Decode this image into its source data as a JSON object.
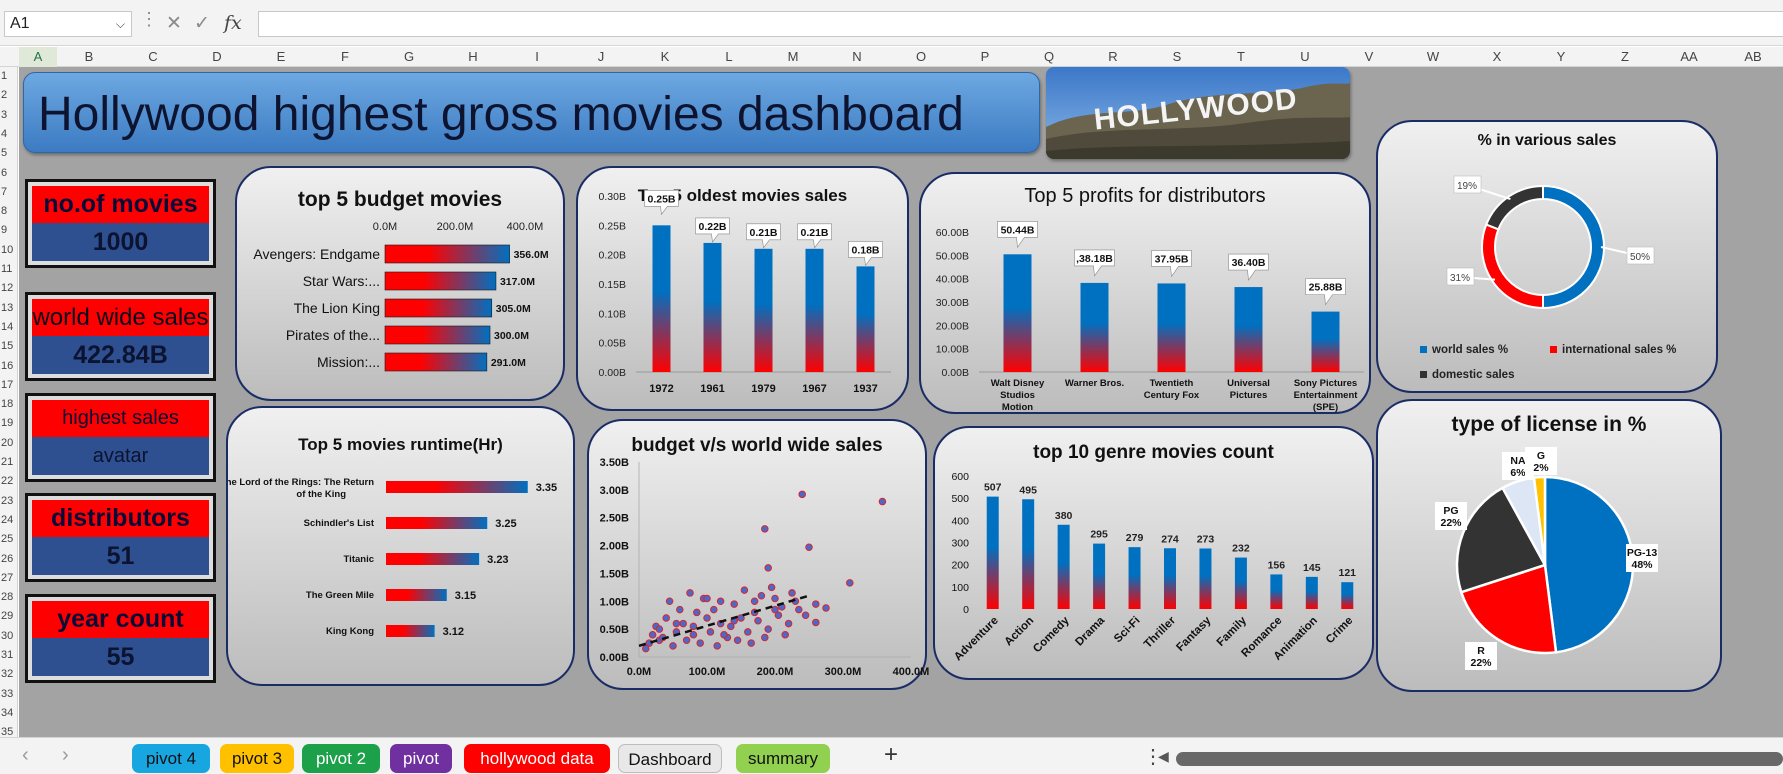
{
  "formula_bar": {
    "name_box": "A1",
    "fx": "fx",
    "formula": ""
  },
  "columns": [
    "A",
    "B",
    "C",
    "D",
    "E",
    "F",
    "G",
    "H",
    "I",
    "J",
    "K",
    "L",
    "M",
    "N",
    "O",
    "P",
    "Q",
    "R",
    "S",
    "T",
    "U",
    "V",
    "W",
    "X",
    "Y",
    "Z",
    "AA",
    "AB"
  ],
  "rows": [
    "1",
    "2",
    "3",
    "4",
    "5",
    "6",
    "7",
    "8",
    "9",
    "10",
    "11",
    "12",
    "13",
    "14",
    "15",
    "16",
    "17",
    "18",
    "19",
    "20",
    "21",
    "22",
    "23",
    "24",
    "25",
    "26",
    "27",
    "28",
    "29",
    "30",
    "31",
    "32",
    "33",
    "34",
    "35"
  ],
  "dashboard": {
    "title": "Hollywood highest gross movies dashboard",
    "banner_text": "HOLLYWOOD",
    "kpis": [
      {
        "label": "no.of movies",
        "value": "1000"
      },
      {
        "label": "world wide sales",
        "value": "422.84B"
      },
      {
        "label": "highest sales",
        "value": "avatar"
      },
      {
        "label": "distributors",
        "value": "51"
      },
      {
        "label": "year count",
        "value": "55"
      }
    ]
  },
  "chart_data": [
    {
      "id": "budget",
      "type": "bar",
      "orientation": "horizontal",
      "title": "top 5 budget movies",
      "categories": [
        "Avengers: Endgame",
        "Star Wars:...",
        "The Lion King",
        "Pirates of the...",
        "Mission:..."
      ],
      "values": [
        356,
        317,
        305,
        300,
        291
      ],
      "data_labels": [
        "356.0M",
        "317.0M",
        "305.0M",
        "300.0M",
        "291.0M"
      ],
      "xlim": [
        0,
        400
      ],
      "tick_labels": [
        "0.0M",
        "200.0M",
        "400.0M"
      ]
    },
    {
      "id": "oldest",
      "type": "bar",
      "title": "Top 5 oldest movies sales",
      "categories": [
        "1972",
        "1961",
        "1979",
        "1967",
        "1937"
      ],
      "values": [
        0.25,
        0.22,
        0.21,
        0.21,
        0.18
      ],
      "data_labels": [
        "0.25B",
        "0.22B",
        "0.21B",
        "0.21B",
        "0.18B"
      ],
      "ylim": [
        0,
        0.3
      ],
      "tick_labels": [
        "0.30B",
        "0.25B",
        "0.20B",
        "0.15B",
        "0.10B",
        "0.05B",
        "0.00B"
      ]
    },
    {
      "id": "profits",
      "type": "bar",
      "title": "Top 5 profits for distributors",
      "categories": [
        "Walt Disney Studios Motion Pictures",
        "Warner Bros.",
        "Twentieth Century Fox",
        "Universal Pictures",
        "Sony Pictures Entertainment (SPE)"
      ],
      "values": [
        50.44,
        38.18,
        37.95,
        36.4,
        25.88
      ],
      "data_labels": [
        "50.44B",
        ",38.18B",
        "37.95B",
        "36.40B",
        "25.88B"
      ],
      "ylim": [
        0,
        60
      ],
      "tick_labels": [
        "60.00B",
        "50.00B",
        "40.00B",
        "30.00B",
        "20.00B",
        "10.00B",
        "0.00B"
      ]
    },
    {
      "id": "sales_pct",
      "type": "pie",
      "subtype": "donut",
      "title": "% in various sales",
      "series": [
        {
          "name": "world sales %",
          "value": 50,
          "label": "50%"
        },
        {
          "name": "international sales %",
          "value": 31,
          "label": "31%"
        },
        {
          "name": "domestic sales",
          "value": 19,
          "label": "19%"
        }
      ],
      "colors": [
        "#0070c0",
        "#ff0000",
        "#333333"
      ]
    },
    {
      "id": "runtime",
      "type": "bar",
      "orientation": "horizontal",
      "title": "Top 5 movies runtime(Hr)",
      "categories": [
        "The Lord of the Rings: The Return of the King",
        "Schindler's List",
        "Titanic",
        "The Green Mile",
        "King Kong"
      ],
      "values": [
        3.35,
        3.25,
        3.23,
        3.15,
        3.12
      ],
      "data_labels": [
        "3.35",
        "3.25",
        "3.23",
        "3.15",
        "3.12"
      ]
    },
    {
      "id": "scatter",
      "type": "scatter",
      "title": "budget v/s world wide sales",
      "xlim": [
        0,
        400
      ],
      "ylim": [
        0,
        3.5
      ],
      "x_tick_labels": [
        "0.0M",
        "100.0M",
        "200.0M",
        "300.0M",
        "400.0M"
      ],
      "y_tick_labels": [
        "3.50B",
        "3.00B",
        "2.50B",
        "2.00B",
        "1.50B",
        "1.00B",
        "0.50B",
        "0.00B"
      ],
      "trendline": {
        "x": [
          0,
          250
        ],
        "y": [
          0.2,
          1.1
        ]
      },
      "points": [
        [
          240,
          2.92
        ],
        [
          358,
          2.79
        ],
        [
          185,
          2.3
        ],
        [
          250,
          1.97
        ],
        [
          190,
          1.6
        ],
        [
          260,
          0.95
        ],
        [
          310,
          1.33
        ],
        [
          275,
          0.88
        ],
        [
          260,
          0.62
        ],
        [
          105,
          0.45
        ],
        [
          30,
          0.3
        ],
        [
          55,
          0.45
        ],
        [
          80,
          0.55
        ],
        [
          120,
          0.6
        ],
        [
          150,
          0.7
        ],
        [
          170,
          0.8
        ],
        [
          200,
          1.05
        ],
        [
          210,
          0.9
        ],
        [
          230,
          1.0
        ],
        [
          180,
          1.1
        ],
        [
          140,
          0.95
        ],
        [
          95,
          1.05
        ],
        [
          60,
          0.85
        ],
        [
          40,
          0.7
        ],
        [
          20,
          0.4
        ],
        [
          15,
          0.25
        ],
        [
          70,
          0.3
        ],
        [
          130,
          0.35
        ],
        [
          160,
          0.45
        ],
        [
          190,
          0.5
        ],
        [
          220,
          0.6
        ],
        [
          45,
          1.0
        ],
        [
          85,
          0.8
        ],
        [
          110,
          0.85
        ],
        [
          75,
          1.15
        ],
        [
          65,
          0.6
        ],
        [
          25,
          0.55
        ],
        [
          50,
          0.2
        ],
        [
          90,
          0.25
        ],
        [
          135,
          0.55
        ],
        [
          175,
          0.65
        ],
        [
          205,
          0.75
        ],
        [
          235,
          0.85
        ],
        [
          155,
          1.2
        ],
        [
          195,
          1.25
        ],
        [
          245,
          0.75
        ],
        [
          100,
          0.7
        ],
        [
          35,
          0.35
        ],
        [
          10,
          0.15
        ],
        [
          125,
          0.4
        ],
        [
          145,
          0.3
        ],
        [
          165,
          0.25
        ],
        [
          185,
          0.35
        ],
        [
          215,
          0.4
        ],
        [
          115,
          0.2
        ],
        [
          80,
          0.4
        ],
        [
          55,
          0.6
        ],
        [
          30,
          0.5
        ],
        [
          140,
          0.65
        ],
        [
          170,
          1.0
        ],
        [
          100,
          1.05
        ],
        [
          120,
          1.0
        ],
        [
          200,
          0.85
        ],
        [
          225,
          1.15
        ]
      ]
    },
    {
      "id": "genre",
      "type": "bar",
      "title": "top 10 genre movies count",
      "categories": [
        "Adventure",
        "Action",
        "Comedy",
        "Drama",
        "Sci-Fi",
        "Thriller",
        "Fantasy",
        "Family",
        "Romance",
        "Animation",
        "Crime"
      ],
      "values": [
        507,
        495,
        380,
        295,
        279,
        274,
        273,
        232,
        156,
        145,
        121
      ],
      "ylim": [
        0,
        600
      ],
      "tick_labels": [
        "600",
        "500",
        "400",
        "300",
        "200",
        "100",
        "0"
      ]
    },
    {
      "id": "license",
      "type": "pie",
      "title": "type of license in %",
      "series": [
        {
          "name": "PG-13",
          "value": 48,
          "label": "PG-13\n48%"
        },
        {
          "name": "R",
          "value": 22,
          "label": "R\n22%"
        },
        {
          "name": "PG",
          "value": 22,
          "label": "PG\n22%"
        },
        {
          "name": "NA",
          "value": 6,
          "label": "NA\n6%"
        },
        {
          "name": "G",
          "value": 2,
          "label": "G\n2%"
        }
      ],
      "colors": [
        "#0070c0",
        "#ff0000",
        "#333333",
        "#dde6f4",
        "#ffc000"
      ]
    }
  ],
  "sheet_tabs": [
    {
      "label": "pivot 4",
      "color": "#18a6e0"
    },
    {
      "label": "pivot 3",
      "color": "#ffc000"
    },
    {
      "label": "pivot 2",
      "color": "#1ca04a"
    },
    {
      "label": "pivot",
      "color": "#7030a0"
    },
    {
      "label": "hollywood data",
      "color": "#ff0000"
    },
    {
      "label": "Dashboard",
      "color": "#dcdcdc",
      "active": true
    },
    {
      "label": "summary",
      "color": "#92d050"
    }
  ],
  "add_sheet": "+"
}
